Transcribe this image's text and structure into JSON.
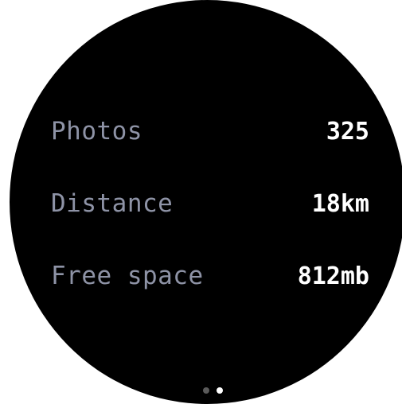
{
  "stats": [
    {
      "label": "Photos",
      "value": "325"
    },
    {
      "label": "Distance",
      "value": "18km"
    },
    {
      "label": "Free space",
      "value": "812mb"
    }
  ],
  "pager": {
    "total_pages": 2,
    "current_page": 2
  },
  "colors": {
    "background": "#000000",
    "label": "#8e93a6",
    "value": "#ffffff",
    "dot_inactive": "#5a5a5a",
    "dot_active": "#ffffff"
  }
}
